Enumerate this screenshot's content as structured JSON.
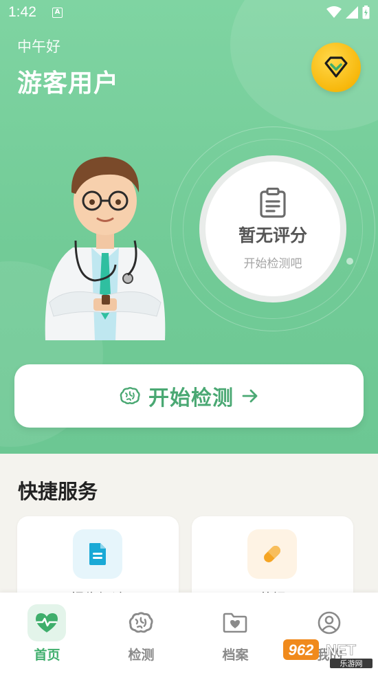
{
  "status_bar": {
    "time": "1:42",
    "notification_badge": "A"
  },
  "header": {
    "greeting": "中午好",
    "username": "游客用户"
  },
  "vip": {
    "icon": "diamond-icon"
  },
  "score": {
    "title": "暂无评分",
    "subtitle": "开始检测吧",
    "icon": "clipboard-icon"
  },
  "start_button": {
    "label": "开始检测",
    "icon": "brain-icon",
    "arrow": "arrow-right-icon"
  },
  "quick_services": {
    "title": "快捷服务",
    "cards": [
      {
        "label": "报告解读",
        "icon": "document-icon",
        "icon_bg": "#e6f5fb",
        "icon_color": "#1aa9d6"
      },
      {
        "label": "用药提醒",
        "icon": "pill-icon",
        "icon_bg": "#fef3e4",
        "icon_color": "#f5a524"
      }
    ]
  },
  "nav": {
    "items": [
      {
        "label": "首页",
        "icon": "heartbeat-icon",
        "active": true
      },
      {
        "label": "检测",
        "icon": "brain-icon",
        "active": false
      },
      {
        "label": "档案",
        "icon": "folder-heart-icon",
        "active": false
      },
      {
        "label": "我的",
        "icon": "user-circle-icon",
        "active": false
      }
    ]
  },
  "watermark": {
    "text": "962.NET",
    "subtext": "乐游网"
  },
  "colors": {
    "primary": "#3fae6c",
    "hero": "#72cb97",
    "vip": "#f7b80c"
  }
}
